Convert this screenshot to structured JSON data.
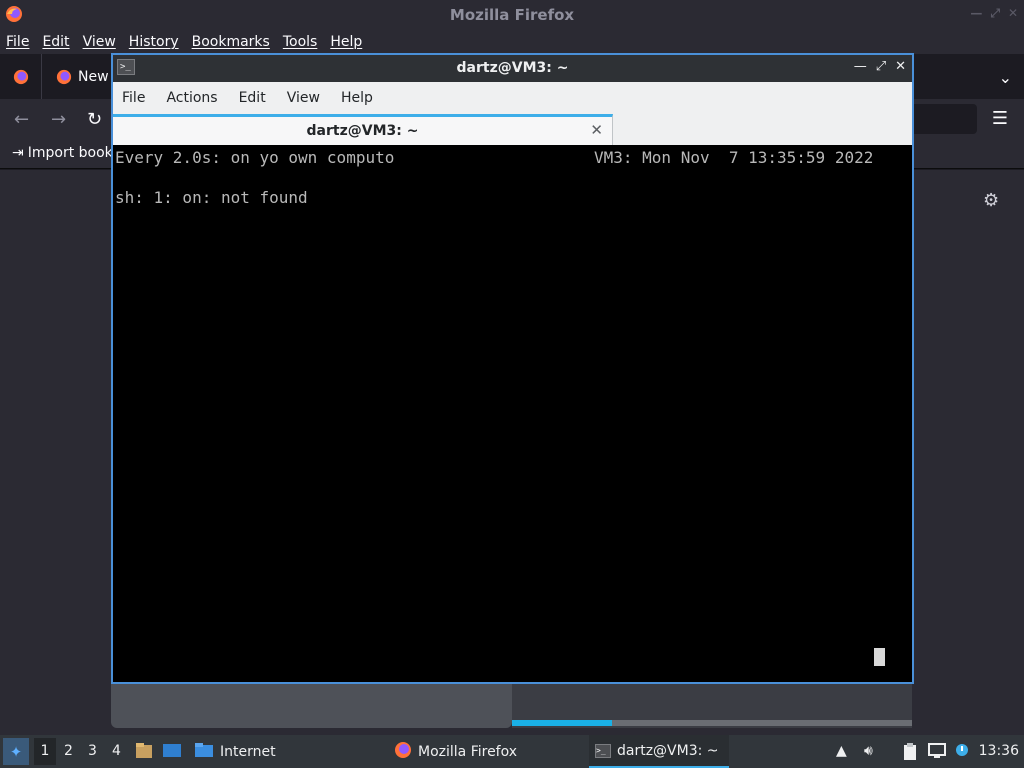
{
  "firefox": {
    "window_title": "Mozilla Firefox",
    "menu": [
      "File",
      "Edit",
      "View",
      "History",
      "Bookmarks",
      "Tools",
      "Help"
    ],
    "tab_label": "New",
    "bookmarks_item": "Import book"
  },
  "terminal": {
    "window_title": "dartz@VM3: ~",
    "menu": [
      "File",
      "Actions",
      "Edit",
      "View",
      "Help"
    ],
    "tab_label": "dartz@VM3: ~",
    "lines": {
      "header_left": "Every 2.0s: on yo own computo",
      "header_right": "VM3: Mon Nov  7 13:35:59 2022",
      "output": "sh: 1: on: not found"
    }
  },
  "taskbar": {
    "desktops": [
      "1",
      "2",
      "3",
      "4"
    ],
    "launcher_label": "Internet",
    "tasks": [
      "Mozilla Firefox",
      "dartz@VM3: ~"
    ],
    "clock": "13:36"
  },
  "colors": {
    "accent": "#3daee9",
    "terminal_bg": "#000000",
    "terminal_fg": "#b8b8b8",
    "firefox_bg": "#2b2a33"
  }
}
